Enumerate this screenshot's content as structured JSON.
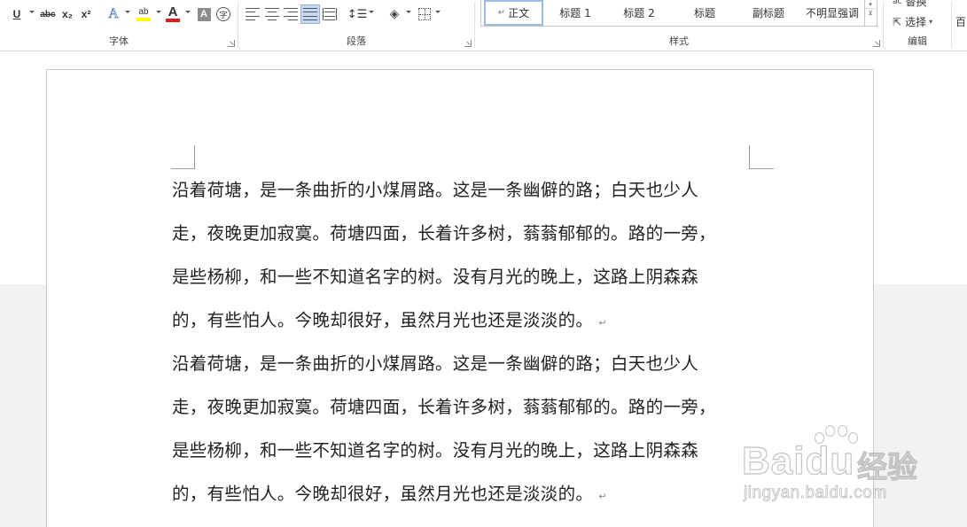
{
  "ribbon": {
    "font_group": {
      "label": "字体",
      "underline": "U",
      "strike": "abc",
      "subscript": "x₂",
      "superscript": "x²",
      "effects": "A",
      "highlight": "ab",
      "font_color": "A",
      "shading": "A",
      "enclose": "字",
      "highlight_color": "#ffff00",
      "font_color_value": "#e11c1c"
    },
    "paragraph_group": {
      "label": "段落"
    },
    "styles_group": {
      "label": "样式",
      "styles": [
        "正文",
        "标题 1",
        "标题 2",
        "标题",
        "副标题",
        "不明显强调"
      ],
      "selected": "正文"
    },
    "edit_group": {
      "label": "编辑",
      "replace": "替换",
      "select": "选择",
      "partial_right": "百"
    }
  },
  "document": {
    "paragraphs": [
      {
        "lines": [
          "沿着荷塘，是一条曲折的小煤屑路。这是一条幽僻的路；白天也少人",
          "走，夜晚更加寂寞。荷塘四面，长着许多树，蓊蓊郁郁的。路的一旁，",
          "是些杨柳，和一些不知道名字的树。没有月光的晚上，这路上阴森森",
          "的，有些怕人。今晚却很好，虽然月光也还是淡淡的。"
        ]
      },
      {
        "lines": [
          "沿着荷塘，是一条曲折的小煤屑路。这是一条幽僻的路；白天也少人",
          "走，夜晚更加寂寞。荷塘四面，长着许多树，蓊蓊郁郁的。路的一旁，",
          "是些杨柳，和一些不知道名字的树。没有月光的晚上，这路上阴森森",
          "的，有些怕人。今晚却很好，虽然月光也还是淡淡的。"
        ]
      }
    ],
    "paragraph_mark": "↵"
  },
  "watermark": {
    "logo": "Baidu",
    "product": "经验",
    "url": "jingyan.baidu.com"
  }
}
